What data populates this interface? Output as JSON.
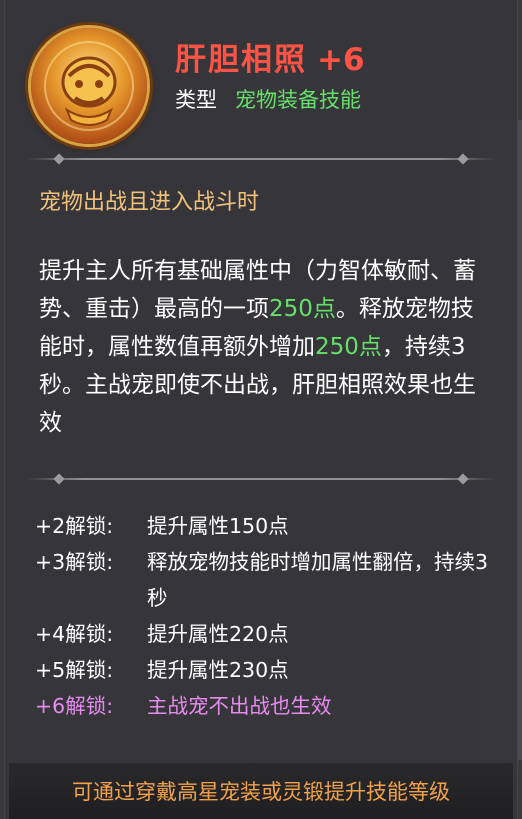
{
  "skill": {
    "name": "肝胆相照",
    "level": "+6",
    "type_label": "类型",
    "type_value": "宠物装备技能"
  },
  "condition": "宠物出战且进入战斗时",
  "description": {
    "p1": "提升主人所有基础属性中（力智体敏耐、蓄势、重击）最高的一项",
    "v1": "250点",
    "p2": "。释放宠物技能时，属性数值再额外增加",
    "v2": "250点",
    "p3": "，持续3秒。主战宠即使不出战，肝胆相照效果也生效"
  },
  "unlocks": [
    {
      "label": "+2解锁:",
      "text": "提升属性150点"
    },
    {
      "label": "+3解锁:",
      "text": "释放宠物技能时增加属性翻倍，持续3秒"
    },
    {
      "label": "+4解锁:",
      "text": "提升属性220点"
    },
    {
      "label": "+5解锁:",
      "text": "提升属性230点"
    },
    {
      "label": "+6解锁:",
      "text": "主战宠不出战也生效"
    }
  ],
  "footer": "可通过穿戴高星宠装或灵锻提升技能等级",
  "colors": {
    "name": "#ff5346",
    "green": "#66e06a",
    "condition": "#f2c27a",
    "special_unlock": "#e88bf0",
    "footer": "#f2a24a"
  }
}
